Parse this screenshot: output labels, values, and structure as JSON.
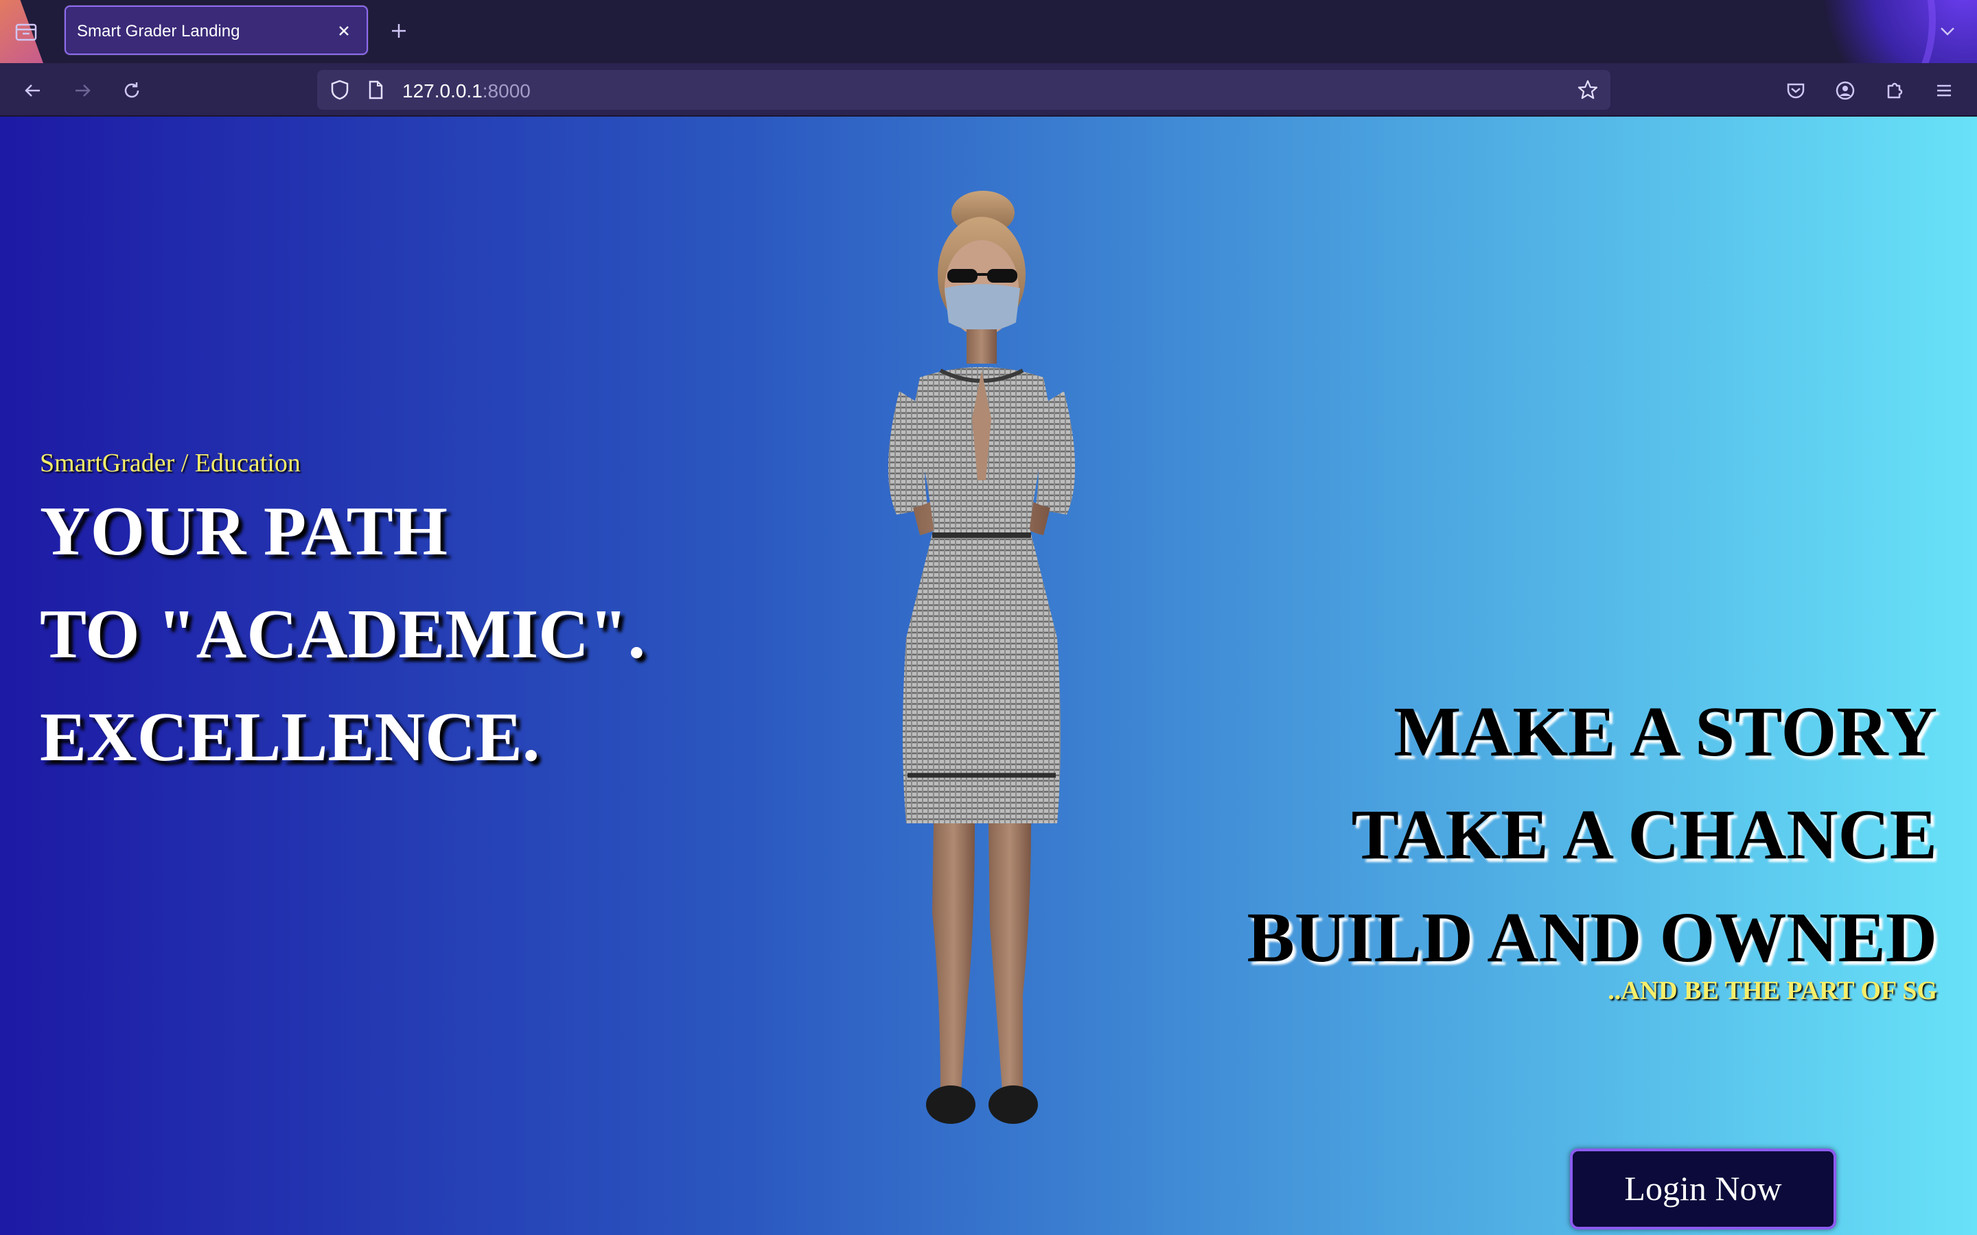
{
  "browser": {
    "tab_title": "Smart Grader Landing",
    "url_host": "127.0.0.1",
    "url_port": ":8000"
  },
  "hero": {
    "eyebrow": "SmartGrader / Education",
    "headline_left": [
      "YOUR PATH",
      "TO \"ACADEMIC\".",
      "EXCELLENCE."
    ],
    "headline_right": [
      "MAKE A STORY",
      "TAKE A CHANCE",
      "BUILD AND OWNED"
    ],
    "tagline": "..AND BE THE PART OF SG",
    "login_label": "Login Now"
  },
  "colors": {
    "gradient_start": "#1d1aa5",
    "gradient_end": "#68e2f8",
    "accent_yellow": "#f6ee6a",
    "button_bg": "#0b0a3a",
    "button_border": "#8c5bf0"
  },
  "icons": {
    "tab_list": "tab-list-icon",
    "close": "close-icon",
    "new_tab": "plus-icon",
    "back": "arrow-left-icon",
    "forward": "arrow-right-icon",
    "reload": "reload-icon",
    "shield": "shield-icon",
    "page": "page-icon",
    "bookmark": "star-icon",
    "pocket": "pocket-icon",
    "account": "account-icon",
    "extensions": "puzzle-icon",
    "menu": "hamburger-menu-icon"
  }
}
